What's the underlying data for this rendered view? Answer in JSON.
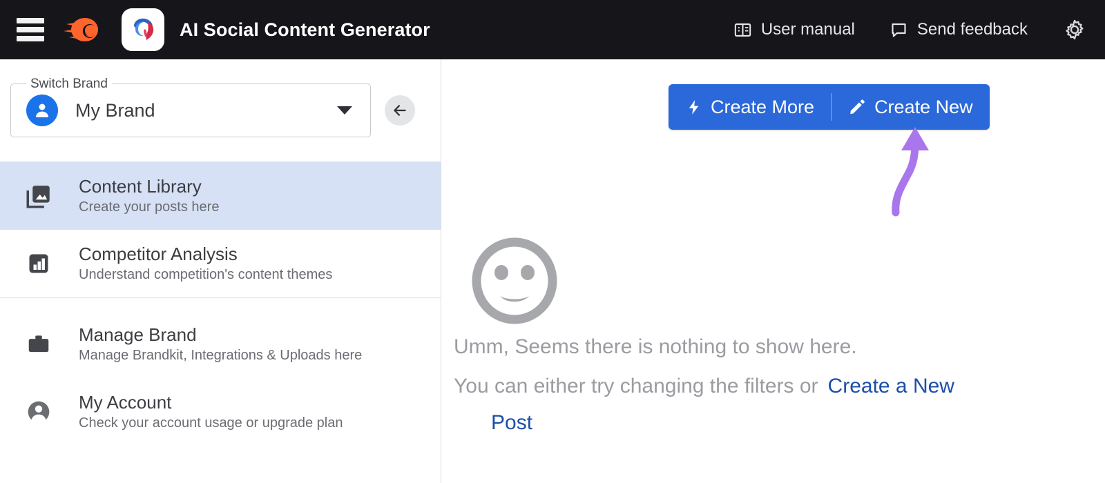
{
  "topbar": {
    "menu_icon": "hamburger-icon",
    "brand_logo_icon": "semrush-comet-icon",
    "app_logo_icon": "ai-social-content-generator-logo",
    "title": "AI Social Content Generator",
    "items": [
      {
        "label": "User manual",
        "icon": "book-icon"
      },
      {
        "label": "Send feedback",
        "icon": "chat-bubble-icon"
      }
    ],
    "settings_icon": "gear-icon",
    "background": "#16161a"
  },
  "sidebar": {
    "brand_switcher": {
      "legend": "Switch Brand",
      "value": "My Brand",
      "avatar_icon": "user-avatar-icon",
      "caret_icon": "chevron-down-icon"
    },
    "collapse_icon": "arrow-left-icon",
    "groups": [
      {
        "items": [
          {
            "title": "Content Library",
            "subtitle": "Create your posts here",
            "icon": "photo-library-icon",
            "active": true
          },
          {
            "title": "Competitor Analysis",
            "subtitle": "Understand competition's content themes",
            "icon": "bar-chart-icon",
            "active": false
          }
        ]
      },
      {
        "items": [
          {
            "title": "Manage Brand",
            "subtitle": "Manage Brandkit, Integrations & Uploads here",
            "icon": "briefcase-icon",
            "active": false
          },
          {
            "title": "My Account",
            "subtitle": "Check your account usage or upgrade plan",
            "icon": "account-circle-icon",
            "active": false
          }
        ]
      }
    ],
    "active_background": "#d6e1f6"
  },
  "main": {
    "create_more": {
      "label": "Create More",
      "icon": "bolt-icon"
    },
    "create_new": {
      "label": "Create New",
      "icon": "pencil-icon"
    },
    "button_color": "#2b68d9",
    "empty_state": {
      "face_icon": "neutral-face-icon",
      "line1": "Umm, Seems there is nothing to show here.",
      "line2": "You can either try changing the filters or",
      "link_part1": "Create a New",
      "link_part2": "Post",
      "text_color": "#9b9ca1",
      "link_color": "#1d4ea8"
    },
    "annotation": {
      "type": "curved-arrow",
      "color": "#aa76ec",
      "points_to": "Create New"
    }
  }
}
